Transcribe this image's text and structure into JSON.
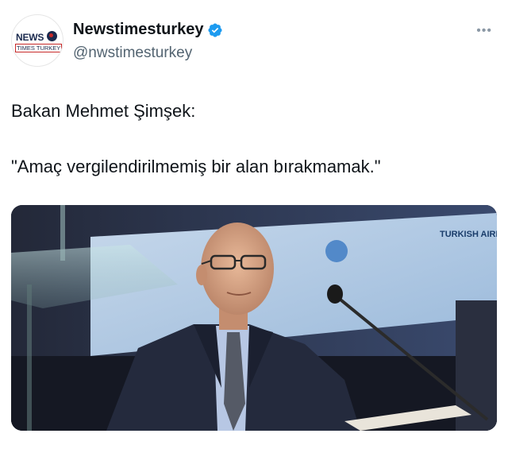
{
  "account": {
    "display_name": "Newstimesturkey",
    "handle": "@nwstimesturkey",
    "verified": true,
    "avatar_logo": {
      "top": "NEWS",
      "bottom": "TIMES TURKEY"
    }
  },
  "tweet": {
    "line1": "Bakan Mehmet Şimşek:",
    "line2": "\"Amaç vergilendirilmemiş bir alan bırakmamak.\""
  },
  "menu": {
    "more_label": "•••"
  },
  "photo": {
    "subject": "man in suit with glasses at conference microphone",
    "background_sign_text": "TURKISH AIRLINES"
  },
  "colors": {
    "verified_blue": "#1d9bf0",
    "handle_gray": "#536471",
    "text": "#0f1419"
  },
  "icons": [
    "verified-badge-icon",
    "more-options-icon"
  ]
}
